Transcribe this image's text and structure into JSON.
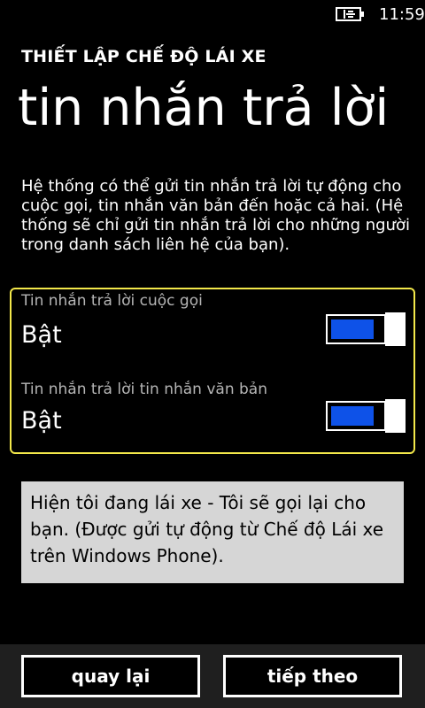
{
  "status_bar": {
    "time": "11:59"
  },
  "header": {
    "section_title": "THIẾT LẬP CHẾ ĐỘ LÁI XE",
    "page_title": "tin nhắn trả lời"
  },
  "description": "Hệ thống có thể gửi tin nhắn trả lời tự động cho cuộc gọi, tin nhắn văn bản đến hoặc cả hai. (Hệ thống sẽ chỉ gửi tin nhắn trả lời cho những người trong danh sách liên hệ của bạn).",
  "toggles": [
    {
      "label": "Tin nhắn trả lời cuộc gọi",
      "state": "Bật",
      "on": true,
      "fill": 0.85
    },
    {
      "label": "Tin nhắn trả lời tin nhắn văn bản",
      "state": "Bật",
      "on": true,
      "fill": 0.85
    }
  ],
  "reply_message": "Hiện tôi đang lái xe - Tôi sẽ gọi lại cho bạn. (Được gửi tự động từ Chế độ Lái xe trên Windows Phone).",
  "app_bar": {
    "back_label": "quay lại",
    "next_label": "tiếp theo"
  },
  "colors": {
    "accent": "#0e52e8",
    "focus_border": "#f3e84a",
    "background": "#000000"
  }
}
